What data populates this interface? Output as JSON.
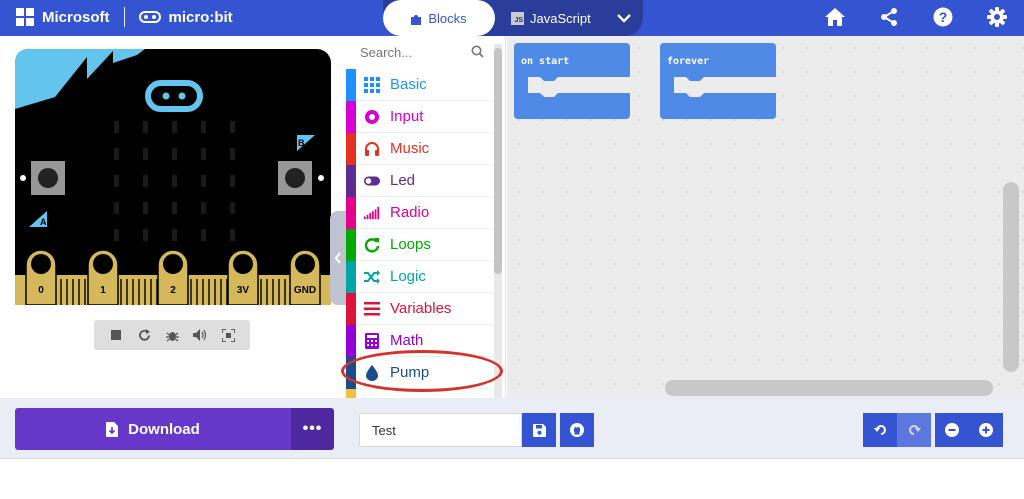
{
  "header": {
    "brand_microsoft": "Microsoft",
    "brand_microbit": "micro:bit",
    "tab_blocks": "Blocks",
    "tab_javascript": "JavaScript",
    "icons": [
      "home-icon",
      "share-icon",
      "help-icon",
      "settings-icon"
    ]
  },
  "simulator": {
    "pins": [
      "0",
      "1",
      "2",
      "3V",
      "GND"
    ],
    "button_a": "A",
    "button_b": "B",
    "toolbar_icons": [
      "stop-icon",
      "restart-icon",
      "debug-icon",
      "sound-icon",
      "fullscreen-icon"
    ]
  },
  "toolbox": {
    "search_placeholder": "Search...",
    "categories": [
      {
        "label": "Basic",
        "color": "#1e90ff",
        "icon": "grid-icon"
      },
      {
        "label": "Input",
        "color": "#d400d4",
        "icon": "target-icon"
      },
      {
        "label": "Music",
        "color": "#e63022",
        "icon": "headphones-icon"
      },
      {
        "label": "Led",
        "color": "#5c2d91",
        "icon": "toggle-icon"
      },
      {
        "label": "Radio",
        "color": "#e3008c",
        "icon": "signal-bars-icon"
      },
      {
        "label": "Loops",
        "color": "#00aa00",
        "icon": "refresh-icon"
      },
      {
        "label": "Logic",
        "color": "#00a4a6",
        "icon": "shuffle-icon"
      },
      {
        "label": "Variables",
        "color": "#dc143c",
        "icon": "list-icon"
      },
      {
        "label": "Math",
        "color": "#9400d3",
        "icon": "calculator-icon"
      },
      {
        "label": "Pump",
        "color": "#1a4c8c",
        "icon": "water-drop-icon"
      }
    ]
  },
  "workspace": {
    "blocks": [
      {
        "label": "on start"
      },
      {
        "label": "forever"
      }
    ],
    "block_color": "#4f8ae6"
  },
  "bottom": {
    "download_label": "Download",
    "more_label": "•••",
    "project_name": "Test"
  },
  "colors": {
    "header": "#3454d1",
    "download": "#6637c8",
    "highlight": "#d0342c"
  }
}
